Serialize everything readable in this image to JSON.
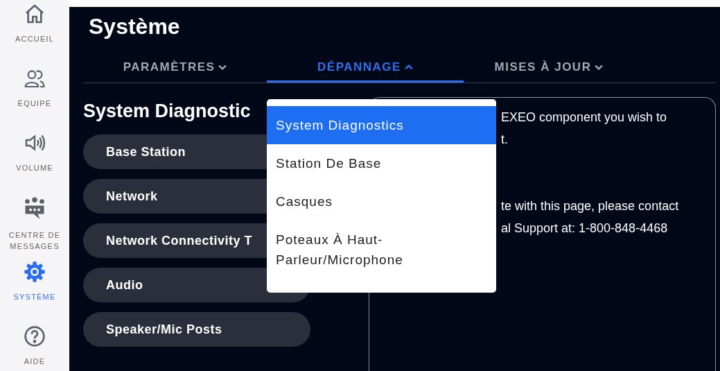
{
  "sidebar": {
    "items": [
      {
        "label": "ACCUEIL",
        "selected": false
      },
      {
        "label": "ÉQUIPE",
        "selected": false
      },
      {
        "label": "VOLUME",
        "selected": false
      },
      {
        "label": "CENTRE DE MESSAGES",
        "selected": false
      },
      {
        "label": "SYSTÈME",
        "selected": true
      },
      {
        "label": "AIDE",
        "selected": false
      }
    ]
  },
  "page_title": "Système",
  "tabs": [
    {
      "label": "PARAMÈTRES",
      "selected": false,
      "expanded": false
    },
    {
      "label": "DÉPANNAGE",
      "selected": true,
      "expanded": true
    },
    {
      "label": "MISES À JOUR",
      "selected": false,
      "expanded": false
    }
  ],
  "section_title": "System Diagnostic",
  "diagnostic_buttons": [
    "Base Station",
    "Network",
    "Network Connectivity T",
    "Audio",
    "Speaker/Mic Posts"
  ],
  "info_panel": {
    "lines": [
      "EXEO component you wish to",
      "t.",
      "te with this page, please contact",
      "al Support at: 1-800-848-4468"
    ]
  },
  "dropdown": {
    "items": [
      {
        "label": "System Diagnostics",
        "selected": true
      },
      {
        "label": "Station De Base",
        "selected": false
      },
      {
        "label": "Casques",
        "selected": false
      },
      {
        "label": "Poteaux À Haut-Parleur/Microphone",
        "selected": false
      }
    ]
  }
}
